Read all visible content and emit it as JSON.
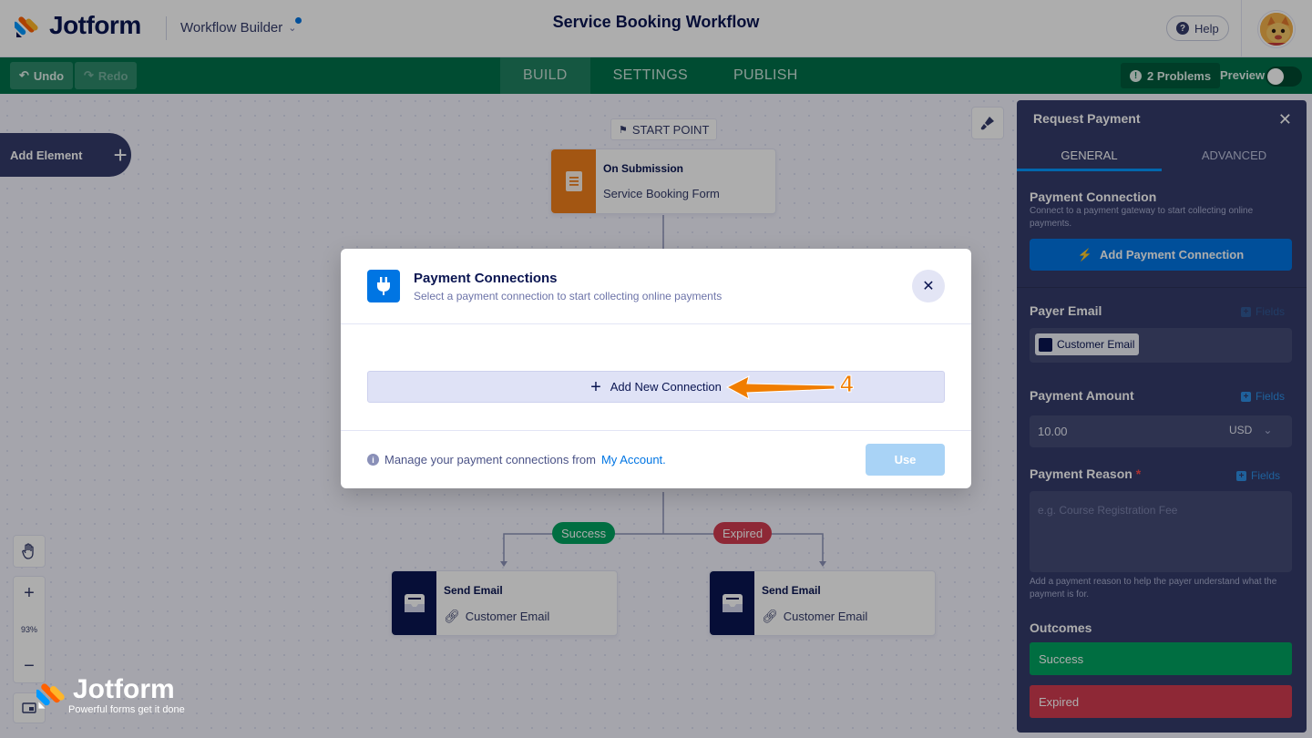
{
  "header": {
    "brand": "Jotform",
    "workflow_builder": "Workflow Builder",
    "title": "Service Booking Workflow",
    "help": "Help"
  },
  "toolbar": {
    "undo": "Undo",
    "redo": "Redo",
    "tabs": [
      "BUILD",
      "SETTINGS",
      "PUBLISH"
    ],
    "problems": "2 Problems",
    "preview": "Preview"
  },
  "canvas": {
    "add_element": "Add Element",
    "start_point": "START POINT",
    "trigger": {
      "title": "On Submission",
      "sub": "Service Booking Form"
    },
    "outcomes": {
      "success": "Success",
      "expired": "Expired"
    },
    "email_nodes": [
      {
        "title": "Send Email",
        "sub": "Customer Email"
      },
      {
        "title": "Send Email",
        "sub": "Customer Email"
      }
    ],
    "zoom": "93%",
    "watermark_brand": "Jotform",
    "watermark_tag": "Powerful forms get it done"
  },
  "panel": {
    "title": "Request Payment",
    "tabs": [
      "GENERAL",
      "ADVANCED"
    ],
    "payment_connection": {
      "title": "Payment Connection",
      "desc": "Connect to a payment gateway to start collecting online payments.",
      "button": "Add Payment Connection"
    },
    "payer_email": {
      "title": "Payer Email",
      "fields": "Fields",
      "chip": "Customer Email"
    },
    "payment_amount": {
      "title": "Payment Amount",
      "fields": "Fields",
      "value": "10.00",
      "currency": "USD"
    },
    "payment_reason": {
      "title": "Payment Reason",
      "required": "*",
      "fields": "Fields",
      "placeholder": "e.g. Course Registration Fee",
      "help": "Add a payment reason to help the payer understand what the payment is for."
    },
    "outcomes": {
      "title": "Outcomes",
      "success": "Success",
      "expired": "Expired"
    }
  },
  "modal": {
    "title": "Payment Connections",
    "subtitle": "Select a payment connection to start collecting online payments",
    "add_connection": "Add New Connection",
    "footer_text": "Manage your payment connections from",
    "footer_link": "My Account.",
    "use_button": "Use",
    "step_number": "4"
  },
  "colors": {
    "toolbar_green": "#00704a",
    "brand_navy": "#0a1551",
    "primary_blue": "#0075e3",
    "success_green": "#00a261",
    "expired_red": "#d23c50",
    "trigger_orange": "#f07f1b",
    "annotation_orange": "#f07d00"
  }
}
